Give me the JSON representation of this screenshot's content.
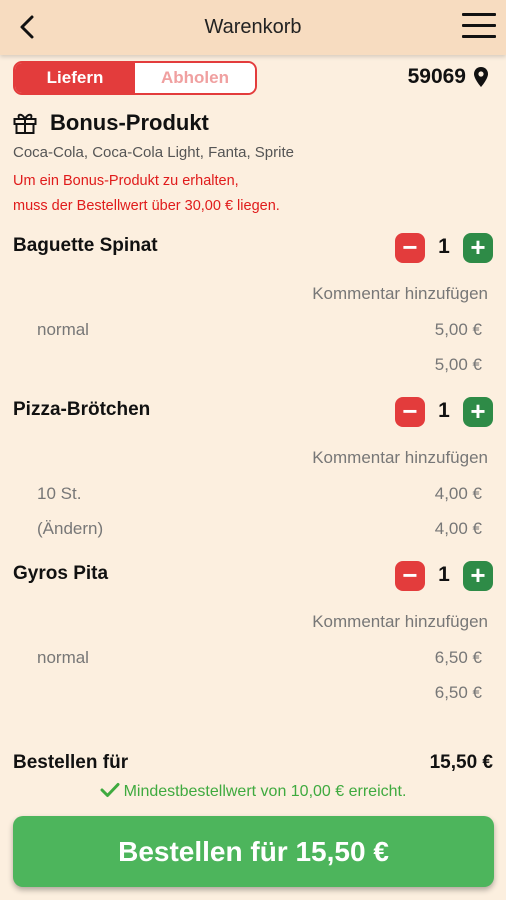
{
  "header": {
    "title": "Warenkorb"
  },
  "mode_toggle": {
    "deliver": "Liefern",
    "pickup": "Abholen"
  },
  "postal_code": "59069",
  "bonus": {
    "title": "Bonus-Produkt",
    "options": "Coca-Cola, Coca-Cola Light, Fanta, Sprite",
    "warning_line1": "Um ein Bonus-Produkt zu erhalten,",
    "warning_line2": "muss der Bestellwert über 30,00 € liegen."
  },
  "items": [
    {
      "name": "Baguette Spinat",
      "qty": "1",
      "comment": "Kommentar hinzufügen",
      "option": "normal",
      "option_price": "5,00 €",
      "subtotal_label": "",
      "subtotal": "5,00 €"
    },
    {
      "name": "Pizza-Brötchen",
      "qty": "1",
      "comment": "Kommentar hinzufügen",
      "option": "10 St.",
      "option_price": "4,00 €",
      "subtotal_label": "(Ändern)",
      "subtotal": "4,00 €"
    },
    {
      "name": "Gyros Pita",
      "qty": "1",
      "comment": "Kommentar hinzufügen",
      "option": "normal",
      "option_price": "6,50 €",
      "subtotal_label": "",
      "subtotal": "6,50 €"
    }
  ],
  "summary": {
    "label": "Bestellen für",
    "total": "15,50 €",
    "min_order_msg": "Mindestbestellwert von 10,00 € erreicht."
  },
  "order_button": "Bestellen für 15,50 €",
  "qty_controls": {
    "minus": "−",
    "plus": "+"
  },
  "colors": {
    "accent_red": "#e33c3c",
    "accent_green": "#2e8b47",
    "order_green": "#4db55c",
    "background": "#fcefdf",
    "header_bg": "#f7dcc0"
  }
}
